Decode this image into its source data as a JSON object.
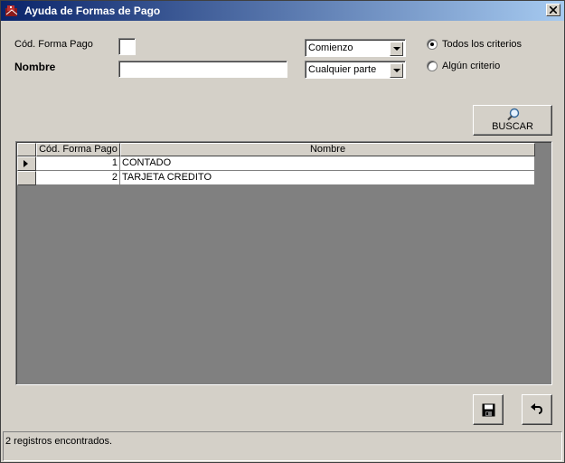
{
  "window": {
    "title": "Ayuda de Formas de Pago"
  },
  "form": {
    "code_label": "Cód. Forma Pago",
    "code_value": "",
    "name_label": "Nombre",
    "name_value": "",
    "match_mode_1": "Comienzo",
    "match_mode_2": "Cualquier parte",
    "radio_all": "Todos los criterios",
    "radio_any": "Algún criterio",
    "radio_selected": "Todos los criterios"
  },
  "search_button": {
    "label": "BUSCAR"
  },
  "grid": {
    "columns": [
      "Cód. Forma Pago",
      "Nombre"
    ],
    "rows": [
      {
        "code": "1",
        "name": "CONTADO",
        "current": true
      },
      {
        "code": "2",
        "name": "TARJETA CREDITO",
        "current": false
      }
    ]
  },
  "status": {
    "text": "2 registros encontrados."
  },
  "icons": {
    "app": "app-icon",
    "close": "close-icon",
    "search": "magnifier-icon",
    "save": "floppy-disk-icon",
    "undo": "undo-arrow-icon"
  }
}
